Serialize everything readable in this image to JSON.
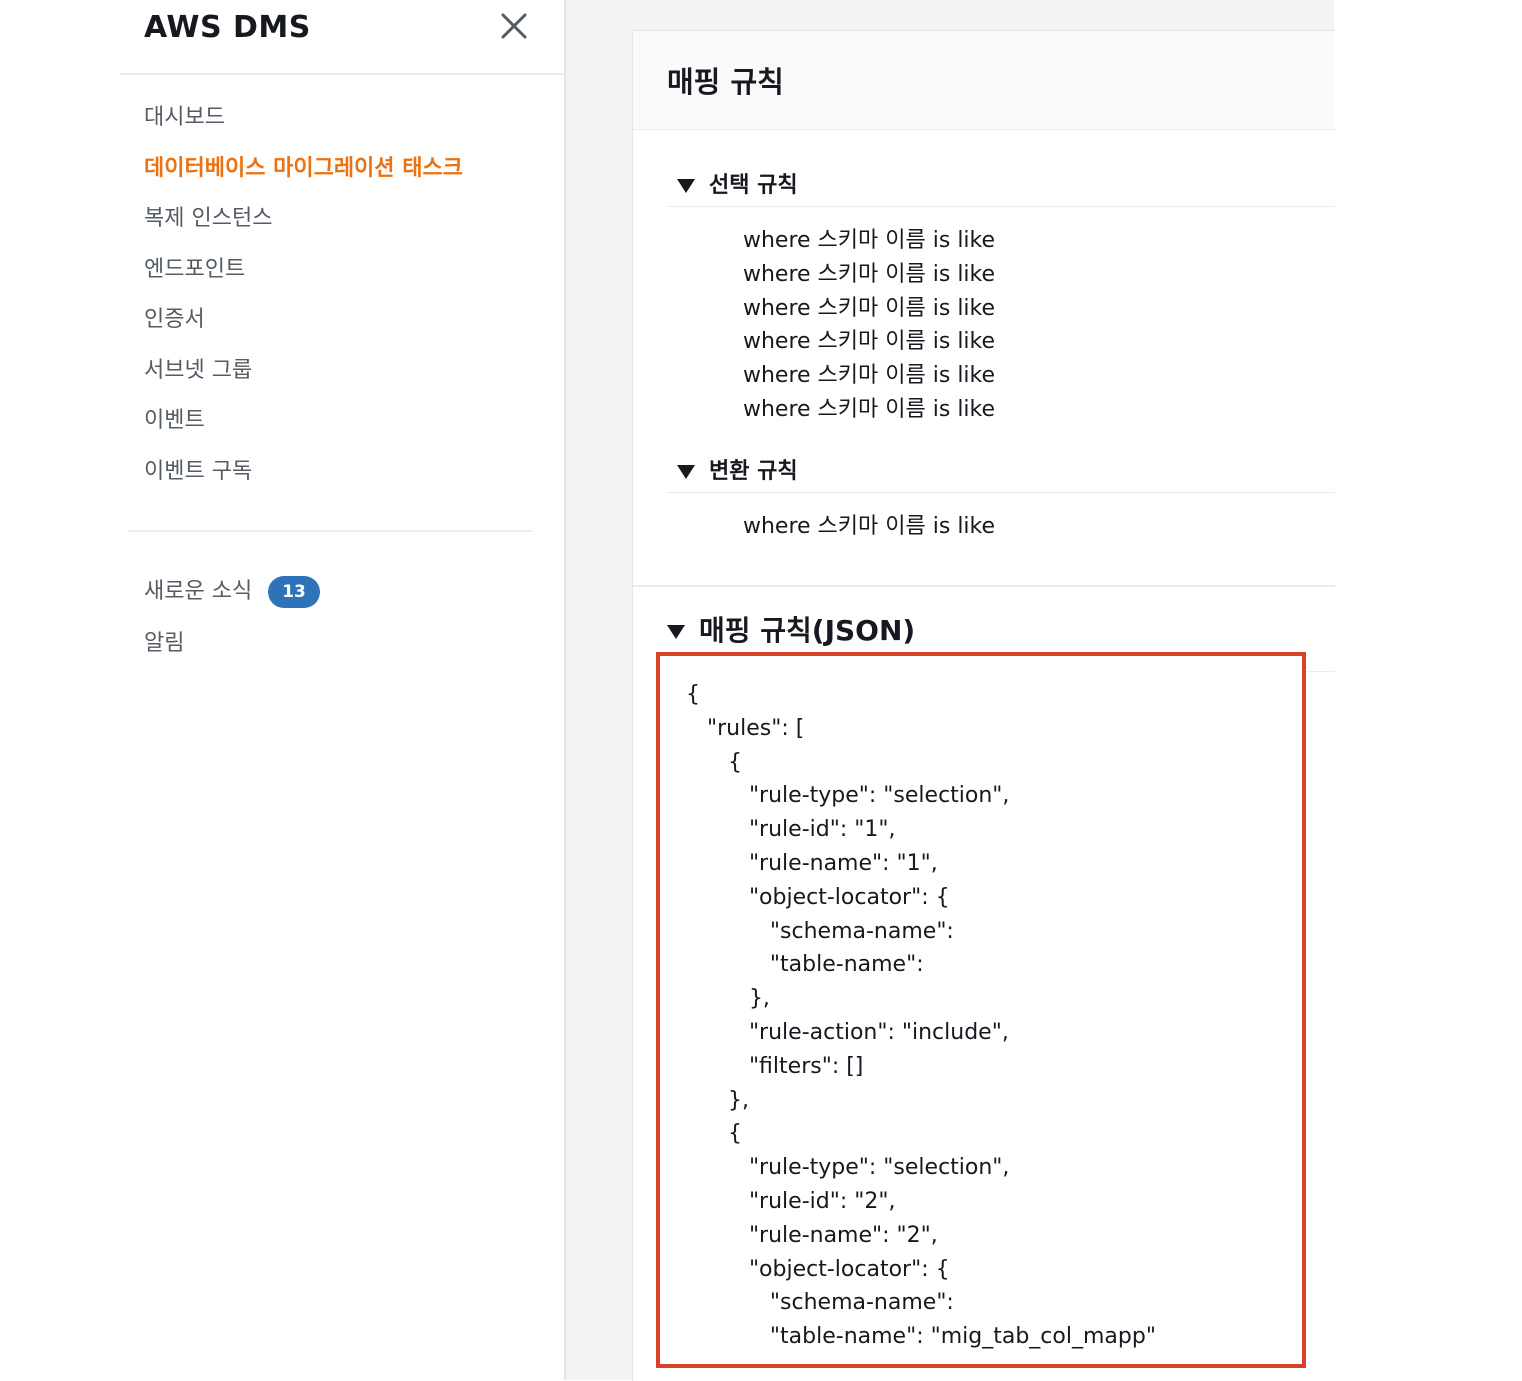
{
  "sidebar": {
    "title": "AWS DMS",
    "close_icon": "close-icon",
    "nav_items": [
      {
        "label": "대시보드",
        "active": false
      },
      {
        "label": "데이터베이스 마이그레이션 태스크",
        "active": true
      },
      {
        "label": "복제 인스턴스",
        "active": false
      },
      {
        "label": "엔드포인트",
        "active": false
      },
      {
        "label": "인증서",
        "active": false
      },
      {
        "label": "서브넷 그룹",
        "active": false
      },
      {
        "label": "이벤트",
        "active": false
      },
      {
        "label": "이벤트 구독",
        "active": false
      }
    ],
    "secondary_items": [
      {
        "label": "새로운 소식",
        "badge": "13"
      },
      {
        "label": "알림"
      }
    ],
    "accent_color": "#ec7211",
    "badge_color": "#2e73b8"
  },
  "main": {
    "panel_title": "매핑 규칙",
    "selection_rules": {
      "heading": "선택 규칙",
      "items": [
        "where 스키마 이름 is like",
        "where 스키마 이름 is like",
        "where 스키마 이름 is like",
        "where 스키마 이름 is like",
        "where 스키마 이름 is like",
        "where 스키마 이름 is like"
      ]
    },
    "transformation_rules": {
      "heading": "변환 규칙",
      "items": [
        "where 스키마 이름 is like"
      ]
    },
    "json_section": {
      "heading": "매핑 규칙(JSON)",
      "highlight_color": "#d9412b",
      "lines": [
        "{",
        "   \"rules\": [",
        "      {",
        "         \"rule-type\": \"selection\",",
        "         \"rule-id\": \"1\",",
        "         \"rule-name\": \"1\",",
        "         \"object-locator\": {",
        "            \"schema-name\":",
        "            \"table-name\":",
        "         },",
        "         \"rule-action\": \"include\",",
        "         \"filters\": []",
        "      },",
        "      {",
        "         \"rule-type\": \"selection\",",
        "         \"rule-id\": \"2\",",
        "         \"rule-name\": \"2\",",
        "         \"object-locator\": {",
        "            \"schema-name\":",
        "            \"table-name\": \"mig_tab_col_mapp\""
      ]
    }
  }
}
